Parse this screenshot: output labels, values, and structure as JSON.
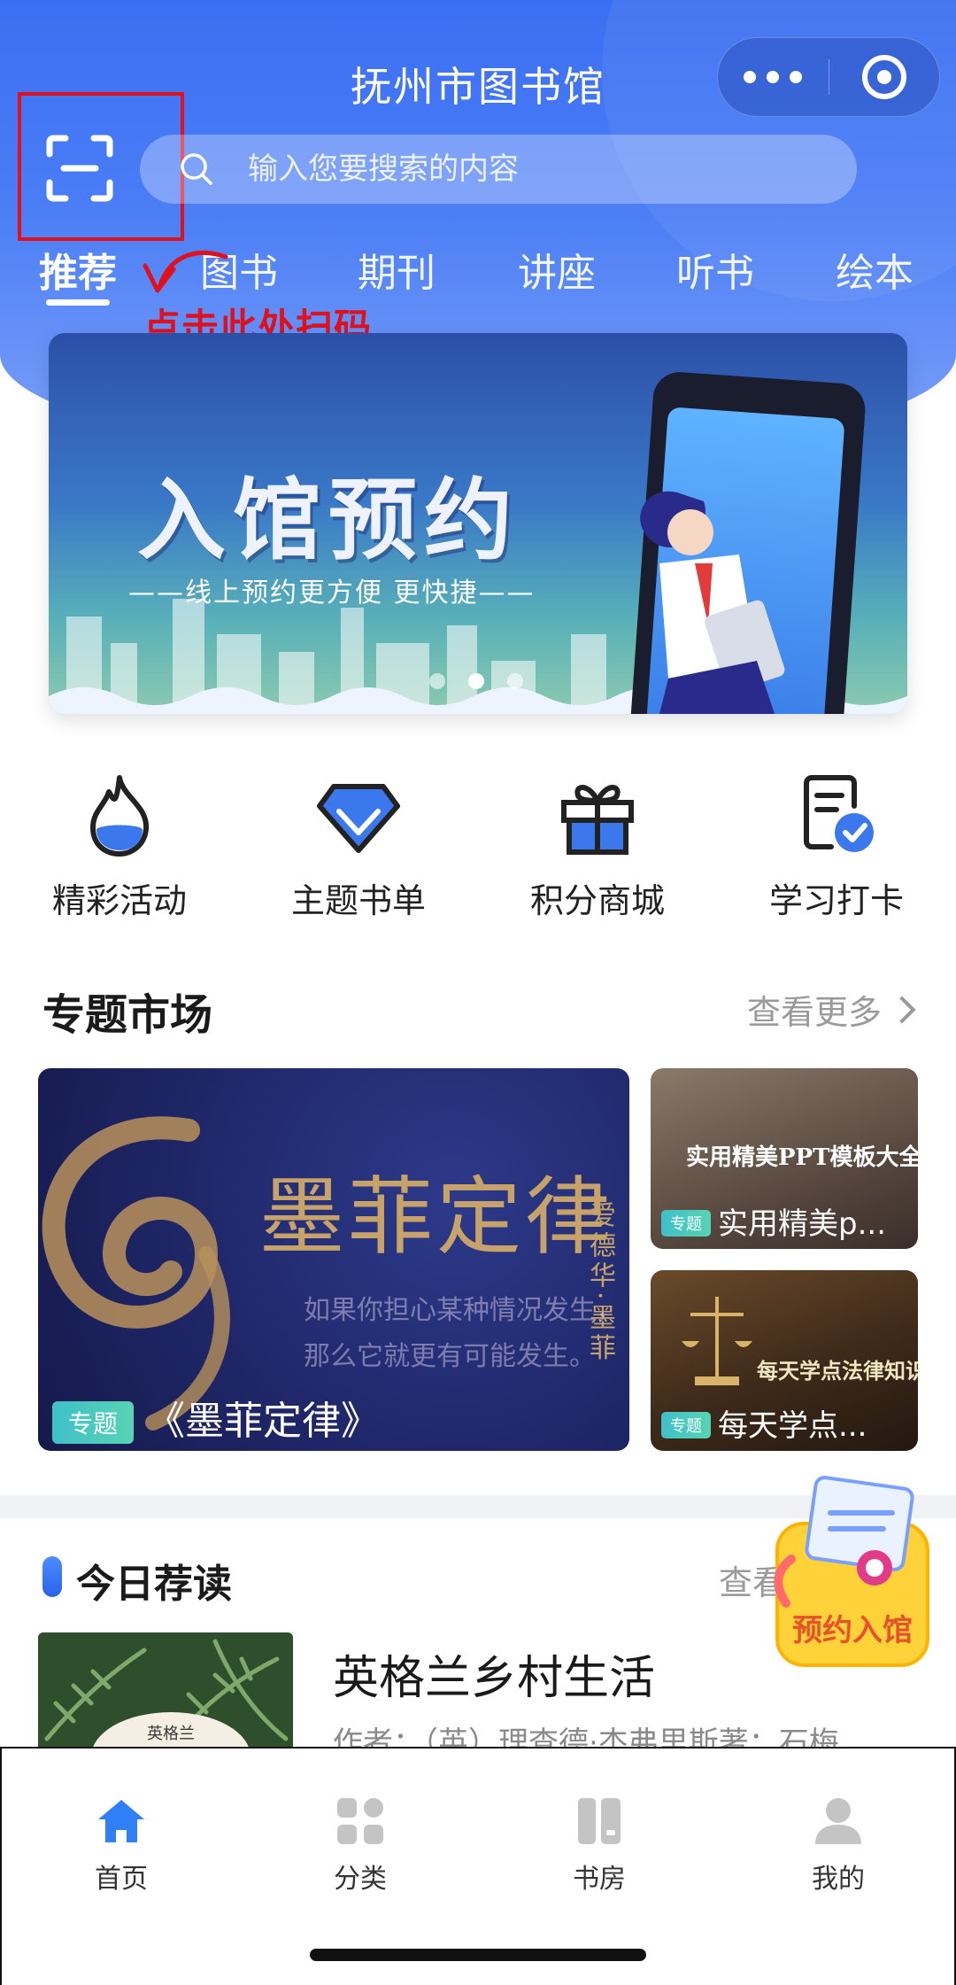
{
  "header": {
    "title": "抚州市图书馆",
    "search_placeholder": "输入您要搜索的内容",
    "annotation": "点击此处扫码"
  },
  "tabs": [
    {
      "label": "推荐",
      "active": true
    },
    {
      "label": "图书"
    },
    {
      "label": "期刊"
    },
    {
      "label": "讲座"
    },
    {
      "label": "听书"
    },
    {
      "label": "绘本"
    }
  ],
  "banner": {
    "title": "入馆预约",
    "subtitle": "——线上预约更方便 更快捷——",
    "slide_count": 3,
    "active_slide": 1
  },
  "quick_entries": [
    {
      "label": "精彩活动",
      "icon": "flame-icon"
    },
    {
      "label": "主题书单",
      "icon": "diamond-icon"
    },
    {
      "label": "积分商城",
      "icon": "gift-icon"
    },
    {
      "label": "学习打卡",
      "icon": "checklist-icon"
    }
  ],
  "topic_market": {
    "title": "专题市场",
    "more": "查看更多",
    "main_card": {
      "art_title": "墨菲定律",
      "art_author": "爱德华·墨菲",
      "art_line1": "如果你担心某种情况发生，",
      "art_line2": "那么它就更有可能发生。",
      "tag": "专题",
      "name": "《墨菲定律》"
    },
    "side_cards": [
      {
        "art_title": "实用精美PPT模板大全",
        "tag": "专题",
        "name": "实用精美p..."
      },
      {
        "art_title": "每天学点法律知识",
        "tag": "专题",
        "name": "每天学点..."
      }
    ]
  },
  "today": {
    "title": "今日荐读",
    "more": "查看",
    "book": {
      "cover_text": "英格兰",
      "title": "英格兰乡村生活",
      "author": "作者：（英）理查德·杰弗里斯著；石梅"
    },
    "float_badge": "预约入馆"
  },
  "bottom_nav": [
    {
      "label": "首页",
      "active": true
    },
    {
      "label": "分类"
    },
    {
      "label": "书房"
    },
    {
      "label": "我的"
    }
  ],
  "colors": {
    "primary": "#3b6ff2",
    "annotation_red": "#e0101c",
    "tag_teal": "#3fc0c8",
    "gold": "#c7a36a"
  }
}
